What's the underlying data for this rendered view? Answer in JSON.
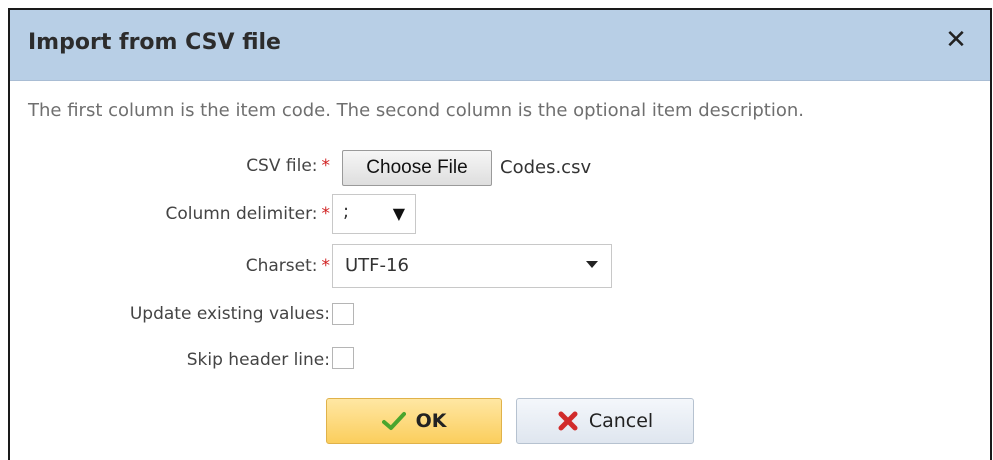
{
  "dialog": {
    "title": "Import from CSV file",
    "close_symbol": "✕",
    "description": "The first column is the item code. The second column is the optional item description."
  },
  "form": {
    "csv_file": {
      "label": "CSV file:",
      "required_mark": "*",
      "button_label": "Choose File",
      "file_name": "Codes.csv"
    },
    "column_delimiter": {
      "label": "Column delimiter:",
      "required_mark": "*",
      "value": ";",
      "arrow_icon": "triangle-down-icon"
    },
    "charset": {
      "label": "Charset:",
      "required_mark": "*",
      "value": "UTF-16",
      "arrow_icon": "caret-down-icon"
    },
    "update_existing": {
      "label": "Update existing values:",
      "checked": false
    },
    "skip_header": {
      "label": "Skip header line:",
      "checked": false
    }
  },
  "buttons": {
    "ok": {
      "label": "OK",
      "icon": "checkmark-icon",
      "color": "#4aa52e"
    },
    "cancel": {
      "label": "Cancel",
      "icon": "x-icon",
      "color": "#d12b2b"
    }
  },
  "colors": {
    "titlebar": "#b8cfe6",
    "required": "#d02020",
    "ok_button": "#fbce5d"
  }
}
